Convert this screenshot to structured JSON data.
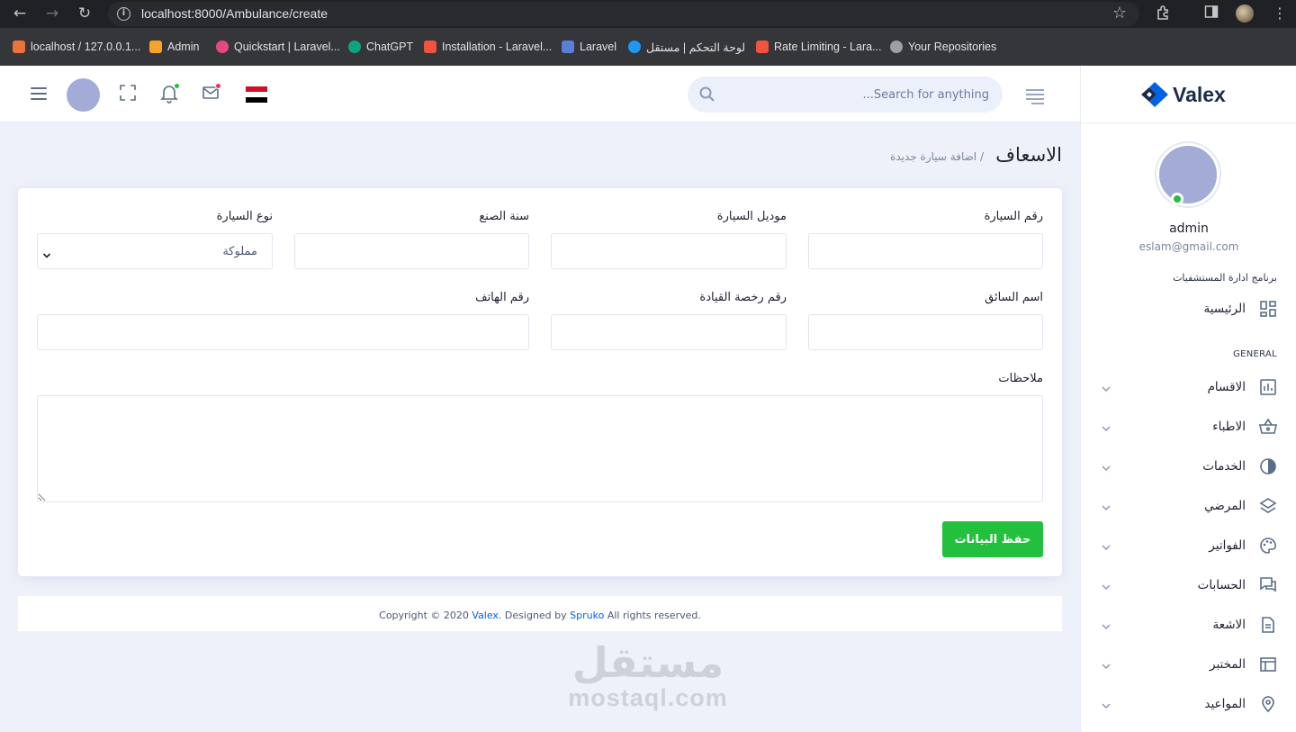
{
  "browser": {
    "url": "localhost:8000/Ambulance/create",
    "bookmarks": [
      {
        "label": "localhost / 127.0.0.1...",
        "color": "#e8743b"
      },
      {
        "label": "Admin",
        "color": "#f6a32a"
      },
      {
        "label": "Quickstart | Laravel...",
        "color": "#e64a7d"
      },
      {
        "label": "ChatGPT",
        "color": "#10a37f"
      },
      {
        "label": "Installation - Laravel...",
        "color": "#f05340"
      },
      {
        "label": "Laravel",
        "color": "#5a7fd6"
      },
      {
        "label": "لوحة التحكم | مستقل",
        "color": "#2196f3"
      },
      {
        "label": "Rate Limiting - Lara...",
        "color": "#f05340"
      },
      {
        "label": "Your Repositories",
        "color": "#9aa0a6"
      }
    ]
  },
  "header": {
    "search_placeholder": "Search for anything...",
    "notification_dot_color": "#22c03c",
    "mail_dot_color": "#ee335e"
  },
  "sidebar": {
    "logo_text": "Valex",
    "user_name": "admin",
    "user_email": "eslam@gmail.com",
    "section_title": "برنامج ادارة المستشفيات",
    "general_label": "GENERAL",
    "home_label": "الرئيسية",
    "items": [
      {
        "label": "الاقسام",
        "icon": "bar-chart-icon"
      },
      {
        "label": "الاطباء",
        "icon": "basket-icon"
      },
      {
        "label": "الخدمات",
        "icon": "pie-icon"
      },
      {
        "label": "المرضي",
        "icon": "layers-icon"
      },
      {
        "label": "الفواتير",
        "icon": "palette-icon"
      },
      {
        "label": "الحسابات",
        "icon": "chat-icon"
      },
      {
        "label": "الاشعة",
        "icon": "document-icon"
      },
      {
        "label": "المختبر",
        "icon": "table-icon"
      },
      {
        "label": "المواعيد",
        "icon": "location-icon"
      }
    ]
  },
  "page": {
    "title": "الاسعاف",
    "breadcrumb": "/  اضافة سيارة جديدة"
  },
  "form": {
    "car_number_label": "رقم السيارة",
    "car_model_label": "موديل السيارة",
    "manufacture_year_label": "سنة الصنع",
    "car_type_label": "نوع السيارة",
    "car_type_value": "مملوكة",
    "driver_name_label": "اسم السائق",
    "license_number_label": "رقم رخصة القيادة",
    "phone_label": "رقم الهاتف",
    "notes_label": "ملاحظات",
    "save_label": "حفظ البيانات"
  },
  "footer": {
    "prefix": "Copyright © 2020 ",
    "brand": "Valex",
    "middle": ". Designed by ",
    "designer": "Spruko",
    "suffix": " All rights reserved."
  },
  "watermark": {
    "arabic": "مستقل",
    "latin": "mostaql.com"
  },
  "colors": {
    "accent_green": "#22c03c",
    "link_blue": "#0162e8",
    "background": "#eef1f9"
  }
}
